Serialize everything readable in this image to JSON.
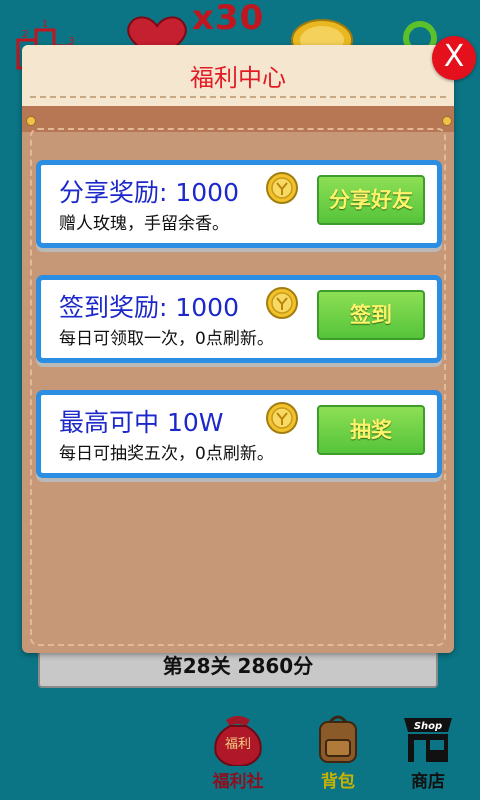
{
  "hud": {
    "lives_count": "x30"
  },
  "dialog": {
    "title": "福利中心",
    "close_label": "X",
    "cards": [
      {
        "title": "分享奖励: 1000",
        "desc": "赠人玫瑰，手留余香。",
        "button": "分享好友"
      },
      {
        "title": "签到奖励: 1000",
        "desc": "每日可领取一次，0点刷新。",
        "button": "签到"
      },
      {
        "title": "最高可中  10W",
        "desc": "每日可抽奖五次，0点刷新。",
        "button": "抽奖"
      }
    ]
  },
  "level_bar": {
    "text": "第28关 2860分"
  },
  "bottom_nav": [
    {
      "label": "福利社",
      "icon": "fortune-bag-icon",
      "color": "#8b1020"
    },
    {
      "label": "背包",
      "icon": "backpack-icon",
      "color": "#c9b200"
    },
    {
      "label": "商店",
      "icon": "shop-icon",
      "color": "#111111"
    }
  ],
  "colors": {
    "background": "#0b7585",
    "title_red": "#e21c26",
    "card_border": "#2b8ee2",
    "card_title": "#1c28c9",
    "button_green": "#55c43b"
  }
}
